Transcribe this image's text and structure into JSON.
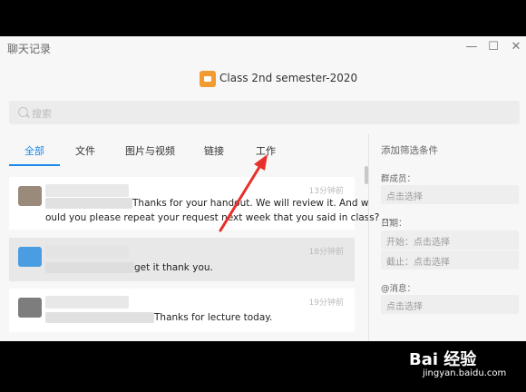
{
  "window": {
    "title": "聊天记录",
    "controls": {
      "minimize_icon": "minimize-icon",
      "maximize_icon": "maximize-icon",
      "close_icon": "close-icon"
    }
  },
  "group": {
    "name": "Class 2nd semester-2020",
    "avatar_color": "#f29b30"
  },
  "search": {
    "placeholder": "搜索",
    "icon": "search-icon"
  },
  "tabs": [
    {
      "label": "全部",
      "active": true
    },
    {
      "label": "文件",
      "active": false
    },
    {
      "label": "图片与视频",
      "active": false
    },
    {
      "label": "链接",
      "active": false
    },
    {
      "label": "工作",
      "active": false
    }
  ],
  "accent_color": "#1a88e8",
  "messages": [
    {
      "time": "13分钟前",
      "line1": "Thanks for your handout. We will review it. And w",
      "line2": "ould you please repeat your request next week that you said in class? ...",
      "selected": false,
      "avatar_color": "#9a8a7c"
    },
    {
      "time": "18分钟前",
      "line1": "get it thank you.",
      "selected": true,
      "avatar_color": "#4a9de0"
    },
    {
      "time": "19分钟前",
      "line1": "Thanks for lecture today.",
      "selected": false,
      "avatar_color": "#7d7d7d"
    }
  ],
  "filter": {
    "title": "添加筛选条件",
    "member_label": "群成员：",
    "member_placeholder": "点击选择",
    "date_label": "日期：",
    "start_placeholder": "开始：点击选择",
    "end_placeholder": "截止：点击选择",
    "mention_label": "@消息：",
    "mention_placeholder": "点击选择"
  },
  "annotation": {
    "arrow_color": "#e8302a",
    "points_to": "工作"
  },
  "watermark": {
    "brand": "Bai 经验",
    "url": "jingyan.baidu.com"
  }
}
